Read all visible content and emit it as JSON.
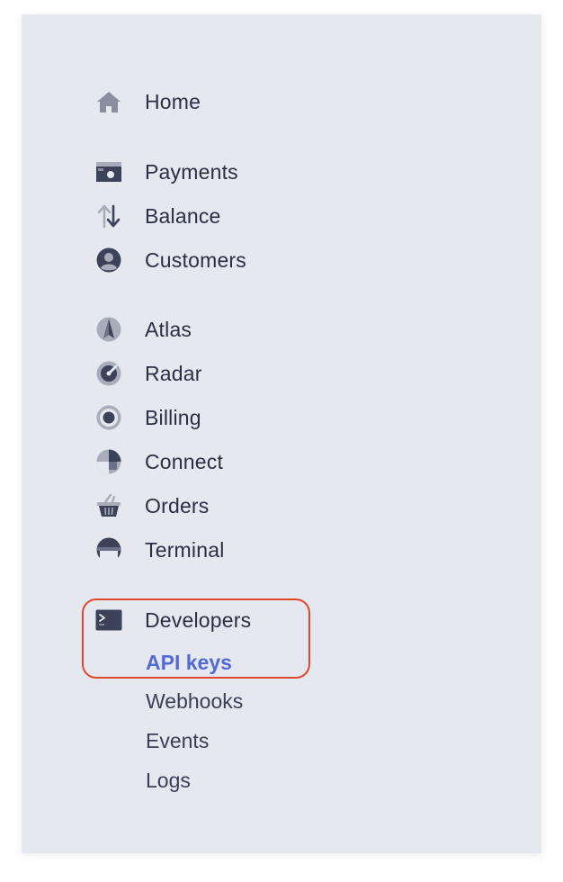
{
  "nav": {
    "home": {
      "label": "Home",
      "icon": "home-icon"
    },
    "payments": {
      "label": "Payments",
      "icon": "payments-icon"
    },
    "balance": {
      "label": "Balance",
      "icon": "balance-arrows-icon"
    },
    "customers": {
      "label": "Customers",
      "icon": "customer-avatar-icon"
    },
    "atlas": {
      "label": "Atlas",
      "icon": "atlas-icon"
    },
    "radar": {
      "label": "Radar",
      "icon": "radar-icon"
    },
    "billing": {
      "label": "Billing",
      "icon": "billing-icon"
    },
    "connect": {
      "label": "Connect",
      "icon": "connect-icon"
    },
    "orders": {
      "label": "Orders",
      "icon": "basket-icon"
    },
    "terminal": {
      "label": "Terminal",
      "icon": "terminal-device-icon"
    },
    "developers": {
      "label": "Developers",
      "icon": "console-icon",
      "subitems": {
        "api_keys": "API keys",
        "webhooks": "Webhooks",
        "events": "Events",
        "logs": "Logs"
      },
      "active": "API keys"
    }
  },
  "colors": {
    "panel_bg": "#e5e8ef",
    "text": "#2b2f44",
    "icon": "#8a8fa0",
    "icon_dark": "#3c4257",
    "active": "#5469d4",
    "highlight_border": "#e2482d"
  }
}
